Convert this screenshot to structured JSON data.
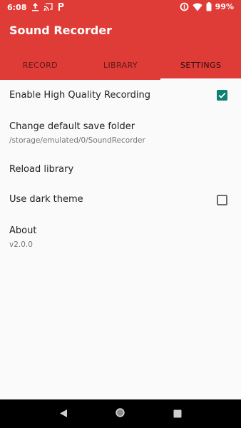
{
  "status_bar": {
    "time": "6:08",
    "battery": "99%",
    "left_icons": [
      "upload-icon",
      "cast-icon",
      "parking-icon"
    ],
    "right_icons": [
      "data-saver-icon",
      "wifi-icon",
      "battery-icon"
    ]
  },
  "app": {
    "title": "Sound Recorder",
    "header_color": "#df3c37"
  },
  "tabs": [
    {
      "label": "RECORD",
      "active": false
    },
    {
      "label": "LIBRARY",
      "active": false
    },
    {
      "label": "SETTINGS",
      "active": true
    }
  ],
  "settings": {
    "high_quality": {
      "title": "Enable High Quality Recording",
      "checked": true
    },
    "save_folder": {
      "title": "Change default save folder",
      "value": "/storage/emulated/0/SoundRecorder"
    },
    "reload": {
      "title": "Reload library"
    },
    "dark_theme": {
      "title": "Use dark theme",
      "checked": false
    },
    "about": {
      "title": "About",
      "version": "v2.0.0"
    }
  },
  "accent_color": "#0e8074",
  "nav_bar": {
    "buttons": [
      "back-icon",
      "home-icon",
      "recents-icon"
    ]
  }
}
